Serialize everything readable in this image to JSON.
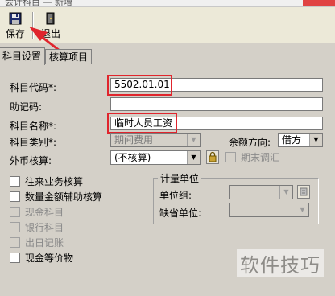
{
  "titlebar": {
    "title": "会计科目 — 新增"
  },
  "toolbar": {
    "save_label": "保存",
    "exit_label": "退出"
  },
  "tabs": [
    {
      "label": "科目设置",
      "active": true
    },
    {
      "label": "核算项目",
      "active": false
    }
  ],
  "form": {
    "code_label": "科目代码*:",
    "code_value": "5502.01.01",
    "mnemonic_label": "助记码:",
    "mnemonic_value": "",
    "name_label": "科目名称*:",
    "name_value": "临时人员工资",
    "category_label": "科目类别*:",
    "category_value": "期间费用",
    "balance_dir_label": "余额方向:",
    "balance_dir_value": "借方",
    "currency_label": "外币核算:",
    "currency_value": "(不核算)",
    "period_end_adjust_label": "期末调汇"
  },
  "checkboxes": [
    {
      "label": "往来业务核算",
      "checked": false,
      "disabled": false
    },
    {
      "label": "数量金额辅助核算",
      "checked": false,
      "disabled": false
    },
    {
      "label": "现金科目",
      "checked": false,
      "disabled": true
    },
    {
      "label": "银行科目",
      "checked": false,
      "disabled": true
    },
    {
      "label": "出日记账",
      "checked": false,
      "disabled": true
    },
    {
      "label": "现金等价物",
      "checked": false,
      "disabled": false
    }
  ],
  "unit_group": {
    "title": "计量单位",
    "group_label": "单位组:",
    "group_value": "",
    "default_unit_label": "缺省单位:",
    "default_unit_value": ""
  },
  "watermark": "软件技巧",
  "colors": {
    "highlight": "#e0252d",
    "panel": "#d4d0c8"
  },
  "icons": {
    "save": "floppy-disk-icon",
    "exit": "exit-door-icon",
    "currency_btn": "lock-icon",
    "unit_btn": "list-icon"
  }
}
